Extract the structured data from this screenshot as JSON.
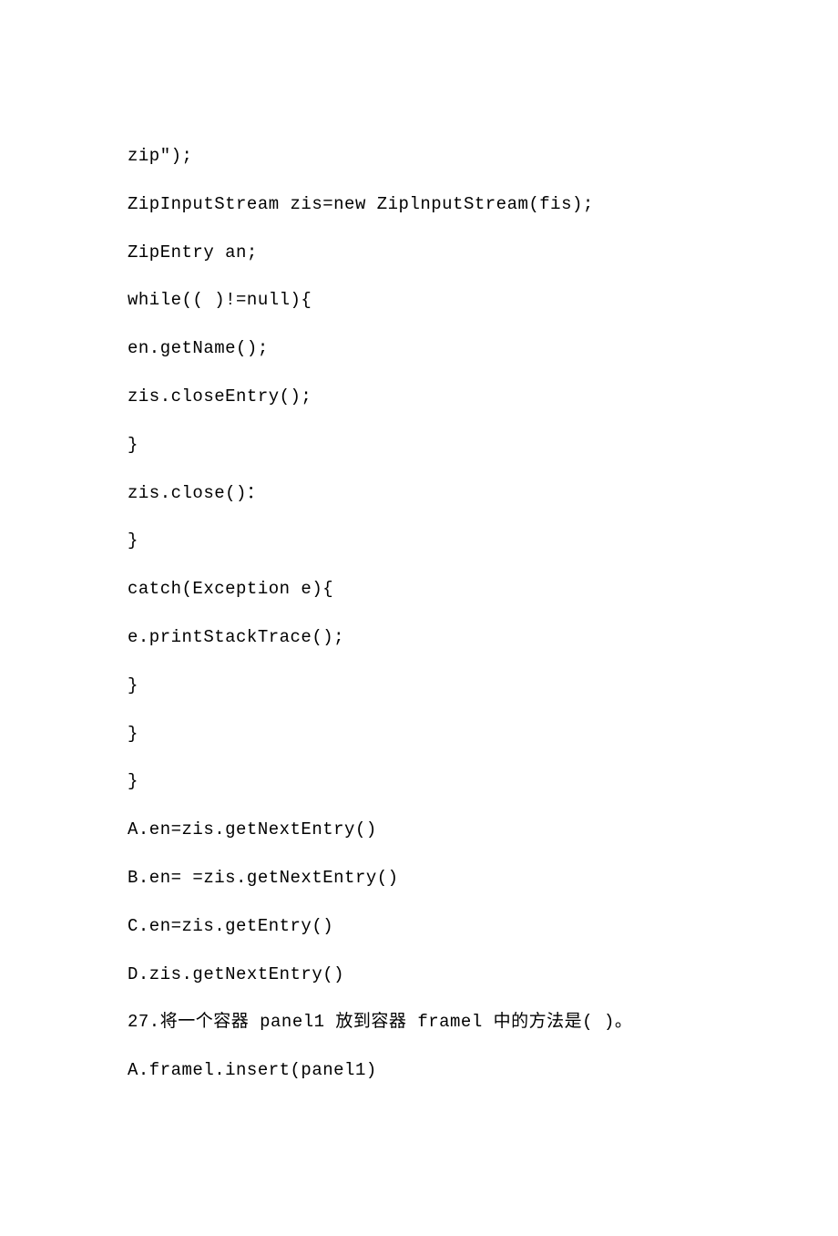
{
  "lines": [
    "zip\"); ",
    "ZipInputStream zis=new ZiplnputStream(fis);",
    "ZipEntry an;",
    "while(( )!=null){",
    "en.getName();",
    "zis.closeEntry();",
    "}",
    "zis.close()：",
    "}",
    "catch(Exception e){",
    "e.printStackTrace();",
    "}",
    "}",
    "}",
    "A.en=zis.getNextEntry()",
    "B.en= =zis.getNextEntry()",
    "C.en=zis.getEntry()",
    "D.zis.getNextEntry()",
    "27.将一个容器 panel1 放到容器 framel 中的方法是( )。",
    "A.framel.insert(panel1)"
  ]
}
